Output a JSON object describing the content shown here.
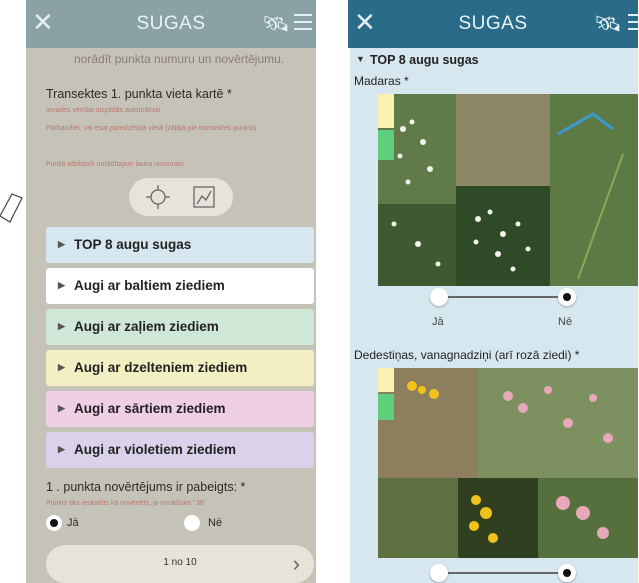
{
  "left": {
    "app_title": "SUGAS",
    "cut_text": "norādīt punkta numuru un novērtējumu.",
    "field_label": "Transektes 1. punkta vieta kartē *",
    "hint1": "Ievades vērtība aizpildās automātiski",
    "hint2": "Pārbaudiet, vai esat paredzētajā vietā (zāļājā pie transektes punkta)",
    "hint3": "Punkti atbilstoši norādītajam lauka numuram",
    "sections": [
      {
        "label": "TOP 8 augu sugas",
        "color": "#d7e7ef"
      },
      {
        "label": "Augi ar baltiem ziediem",
        "color": "#ffffff"
      },
      {
        "label": "Augi ar zaļiem ziediem",
        "color": "#cfe7d6"
      },
      {
        "label": "Augi ar dzelteniem ziediem",
        "color": "#f2efc2"
      },
      {
        "label": "Augi ar sārtiem ziediem",
        "color": "#efcfe6"
      },
      {
        "label": "Augi ar violetiem ziediem",
        "color": "#d9d2ea"
      }
    ],
    "question": "1 . punkta novērtējums ir pabeigts: *",
    "question_hint": "Punkts tiks ieskaitīts kā novērtēts, ja norādīsiet \"Jā\"",
    "opt_yes": "Jā",
    "opt_no": "Nē",
    "pager": "1 no 10"
  },
  "right": {
    "app_title": "SUGAS",
    "header": "TOP 8 augu sugas",
    "species1": "Madaras *",
    "species2": "Dedestiņas, vanagnadziņi (arī rozā ziedi) *",
    "yes": "Jā",
    "no": "Nē"
  },
  "colors": {
    "bar": "#2a6b8a",
    "accent": "#3c9ad0"
  }
}
